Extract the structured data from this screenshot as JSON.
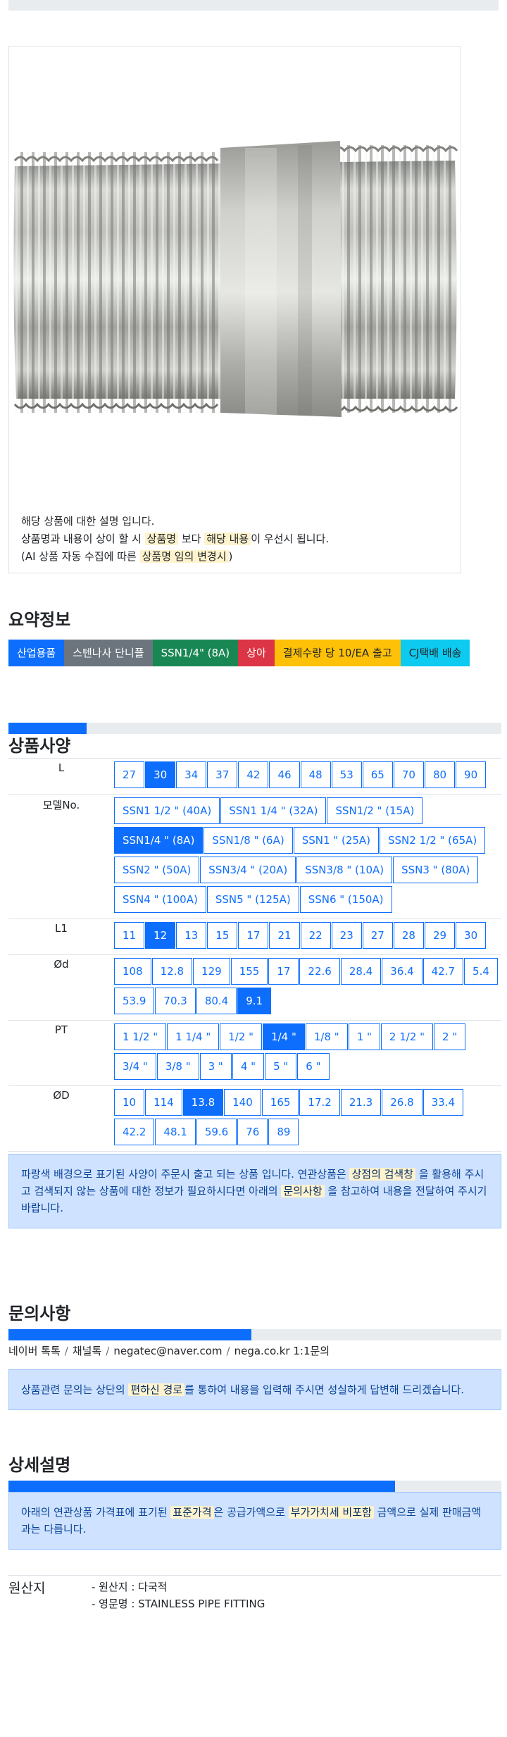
{
  "image_desc": {
    "line1": "해당 상품에 대한 설명 입니다.",
    "line2_a": "상품명과 내용이 상이 할 시",
    "line2_hl1": "상품명",
    "line2_b": "보다",
    "line2_hl2": "해당 내용",
    "line2_c": "이 우선시 됩니다.",
    "line3_a": "(AI 상품 자동 수집에 따른",
    "line3_hl": "상품명 임의 변경시",
    "line3_b": ")"
  },
  "summary": {
    "title": "요약정보",
    "badges": [
      {
        "label": "산업용품",
        "color": "blue"
      },
      {
        "label": "스텐나사 단니플",
        "color": "gray"
      },
      {
        "label": "SSN1/4\" (8A)",
        "color": "green"
      },
      {
        "label": "상아",
        "color": "red"
      },
      {
        "label": "결제수량 당 10/EA 출고",
        "color": "yellow"
      },
      {
        "label": "CJ택배 배송",
        "color": "cyan"
      }
    ]
  },
  "spec": {
    "title": "상품사양",
    "progress_fraction": 0.158,
    "rows": [
      {
        "label": "L",
        "options": [
          "27",
          "30",
          "34",
          "37",
          "42",
          "46",
          "48",
          "53",
          "65",
          "70",
          "80",
          "90"
        ],
        "selected": "30"
      },
      {
        "label": "모델No.",
        "options": [
          "SSN1 1/2 \" (40A)",
          "SSN1 1/4 \" (32A)",
          "SSN1/2 \" (15A)",
          "SSN1/4 \" (8A)",
          "SSN1/8 \" (6A)",
          "SSN1 \" (25A)",
          "SSN2 1/2 \" (65A)",
          "SSN2 \" (50A)",
          "SSN3/4 \" (20A)",
          "SSN3/8 \" (10A)",
          "SSN3 \" (80A)",
          "SSN4 \" (100A)",
          "SSN5 \" (125A)",
          "SSN6 \" (150A)"
        ],
        "selected": "SSN1/4 \" (8A)"
      },
      {
        "label": "L1",
        "options": [
          "11",
          "12",
          "13",
          "15",
          "17",
          "21",
          "22",
          "23",
          "27",
          "28",
          "29",
          "30"
        ],
        "selected": "12"
      },
      {
        "label": "Ød",
        "options": [
          "108",
          "12.8",
          "129",
          "155",
          "17",
          "22.6",
          "28.4",
          "36.4",
          "42.7",
          "5.4",
          "53.9",
          "70.3",
          "80.4",
          "9.1"
        ],
        "selected": "9.1"
      },
      {
        "label": "PT",
        "options": [
          "1 1/2 \"",
          "1 1/4 \"",
          "1/2 \"",
          "1/4 \"",
          "1/8 \"",
          "1 \"",
          "2 1/2 \"",
          "2 \"",
          "3/4 \"",
          "3/8 \"",
          "3 \"",
          "4 \"",
          "5 \"",
          "6 \""
        ],
        "selected": "1/4 \""
      },
      {
        "label": "ØD",
        "options": [
          "10",
          "114",
          "13.8",
          "140",
          "165",
          "17.2",
          "21.3",
          "26.8",
          "33.4",
          "42.2",
          "48.1",
          "59.6",
          "76",
          "89"
        ],
        "selected": "13.8"
      }
    ],
    "notice": {
      "a": "파랑색 배경으로 표기된 사양이 주문시 출고 되는 상품 입니다. 연관상품은",
      "hl1": "상점의 검색창",
      "b": "을 활용해 주시고 검색되지 않는 상품에 대한 정보가 필요하시다면 아래의",
      "hl2": "문의사항",
      "c": "을 참고하여 내용을 전달하여 주시기 바랍니다."
    }
  },
  "inquiry": {
    "title": "문의사항",
    "progress_fraction": 0.493,
    "links": [
      "네이버 톡톡",
      "채널톡",
      "negatec@naver.com",
      "nega.co.kr 1:1문의"
    ],
    "notice": {
      "a": "상품관련 문의는 상단의",
      "hl": "편하신 경로",
      "b": "를 통하여 내용을 입력해 주시면 성실하게 답변해 드리겠습니다."
    }
  },
  "detail": {
    "title": "상세설명",
    "progress_fraction": 0.784,
    "notice": {
      "a": "아래의 연관상품 가격표에 표기된",
      "hl1": "표준가격",
      "b": "은 공급가액으로",
      "hl2": "부가가치세 비포함",
      "c": "금액으로 실제 판매금액과는 다릅니다."
    }
  },
  "origin": {
    "label": "원산지",
    "items": [
      "- 원산지 : 다국적",
      "- 영문명 : STAINLESS PIPE FITTING"
    ]
  }
}
